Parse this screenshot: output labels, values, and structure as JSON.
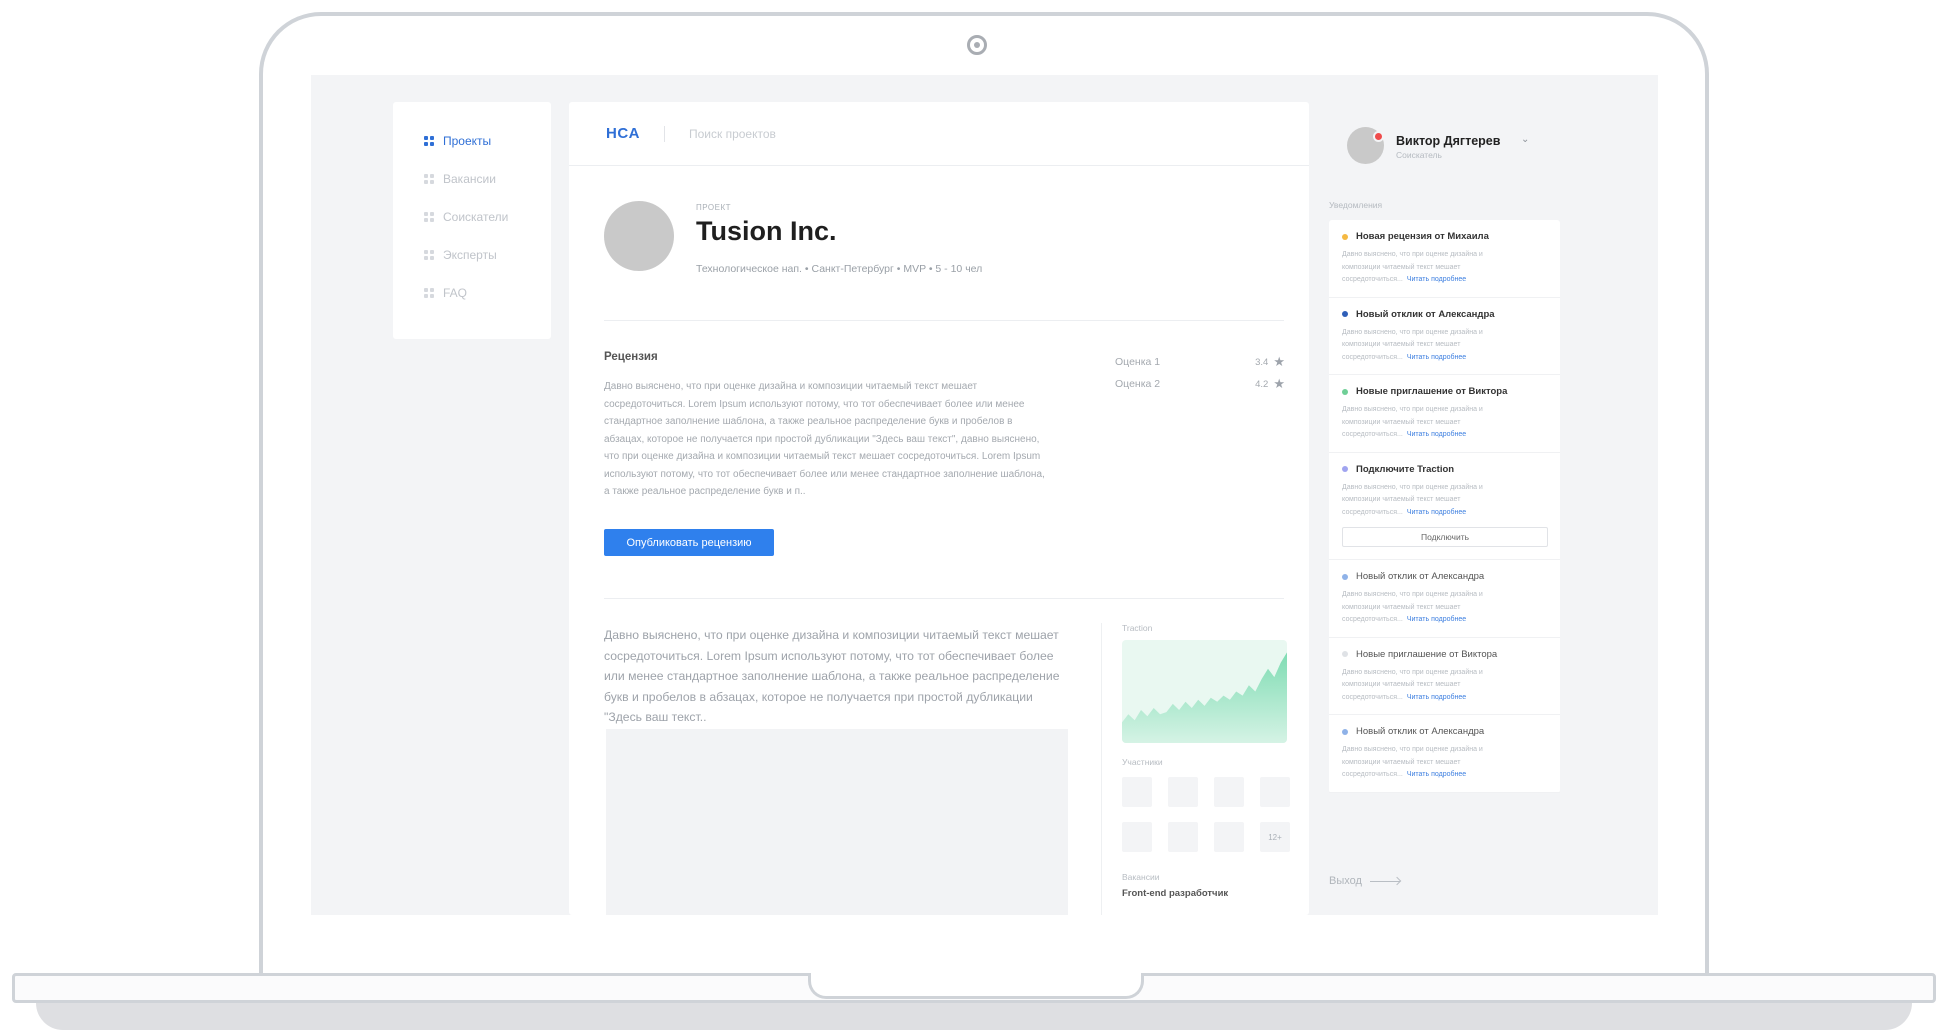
{
  "nav": {
    "items": [
      {
        "label": "Проекты",
        "active": true
      },
      {
        "label": "Вакансии",
        "active": false
      },
      {
        "label": "Соискатели",
        "active": false
      },
      {
        "label": "Эксперты",
        "active": false
      },
      {
        "label": "FAQ",
        "active": false
      }
    ]
  },
  "header": {
    "logo": "HCA",
    "search_placeholder": "Поиск проектов"
  },
  "project": {
    "kicker": "проект",
    "title": "Tusion Inc.",
    "meta": "Технологическое нап.  •  Санкт-Петербург  •  MVP  •  5 - 10 чел"
  },
  "review": {
    "title": "Рецензия",
    "text": "Давно выяснено, что при оценке дизайна и композиции читаемый текст мешает сосредоточиться. Lorem Ipsum используют потому, что тот обеспечивает более или менее стандартное заполнение шаблона, а также реальное распределение букв и пробелов в абзацах, которое не получается при простой дубликации \"Здесь ваш текст\", давно выяснено, что при оценке дизайна и композиции читаемый текст мешает сосредоточиться. Lorem Ipsum используют потому, что тот обеспечивает более или менее стандартное заполнение шаблона, а также реальное распределение букв и п..",
    "publish_label": "Опубликовать рецензию",
    "scores": [
      {
        "label": "Оценка 1",
        "value": "3.4"
      },
      {
        "label": "Оценка 2",
        "value": "4.2"
      }
    ]
  },
  "description": {
    "text": "Давно выяснено, что при оценке дизайна и композиции читаемый текст мешает сосредоточиться. Lorem Ipsum используют потому, что тот обеспечивает более или менее стандартное заполнение шаблона, а также реальное распределение букв и пробелов в абзацах, которое не получается при простой дубликации \"Здесь ваш текст.."
  },
  "sidebar_info": {
    "traction_label": "Traction",
    "participants_label": "Участники",
    "participants_more": "12+",
    "vacancies_label": "Вакансии",
    "vacancy": "Front-end разработчик"
  },
  "chart_data": {
    "type": "area",
    "title": "",
    "xlabel": "",
    "ylabel": "",
    "values": [
      40,
      36,
      39,
      34,
      37,
      33,
      36,
      35,
      31,
      34,
      30,
      33,
      29,
      32,
      28,
      30,
      27,
      29,
      25,
      27,
      22,
      25,
      19,
      14,
      18,
      11,
      6
    ]
  },
  "user": {
    "name": "Виктор Дягтерев",
    "role": "Соискатель"
  },
  "notifications": {
    "label": "Уведомления",
    "link_label": "Читать подробнее",
    "items": [
      {
        "title": "Новая рецензия от Михаила",
        "color": "#f5b942",
        "body": "Давно выяснено, что при оценке дизайна и композиции читаемый текст мешает сосредоточиться...",
        "button": ""
      },
      {
        "title": "Новый отклик от Александра",
        "color": "#2f5fb8",
        "body": "Давно выяснено, что при оценке дизайна и композиции читаемый текст мешает сосредоточиться...",
        "button": ""
      },
      {
        "title": "Новые приглашение от Виктора",
        "color": "#6fcf97",
        "body": "Давно выяснено, что при оценке дизайна и композиции читаемый текст мешает сосредоточиться...",
        "button": ""
      },
      {
        "title": "Подключите Traction",
        "color": "#a0a4f0",
        "body": "Давно выяснено, что при оценке дизайна и композиции читаемый текст мешает сосредоточиться...",
        "button": "Подключить"
      },
      {
        "title": "Новый отклик от Александра",
        "color": "#8fb2e8",
        "body": "Давно выяснено, что при оценке дизайна и композиции читаемый текст мешает сосредоточиться...",
        "button": ""
      },
      {
        "title": "Новые приглашение от Виктора",
        "color": "#dfe2e6",
        "body": "Давно выяснено, что при оценке дизайна и композиции читаемый текст мешает сосредоточиться...",
        "button": ""
      },
      {
        "title": "Новый отклик от Александра",
        "color": "#8fb2e8",
        "body": "Давно выяснено, что при оценке дизайна и композиции читаемый текст мешает сосредоточиться...",
        "button": ""
      }
    ]
  },
  "logout_label": "Выход"
}
